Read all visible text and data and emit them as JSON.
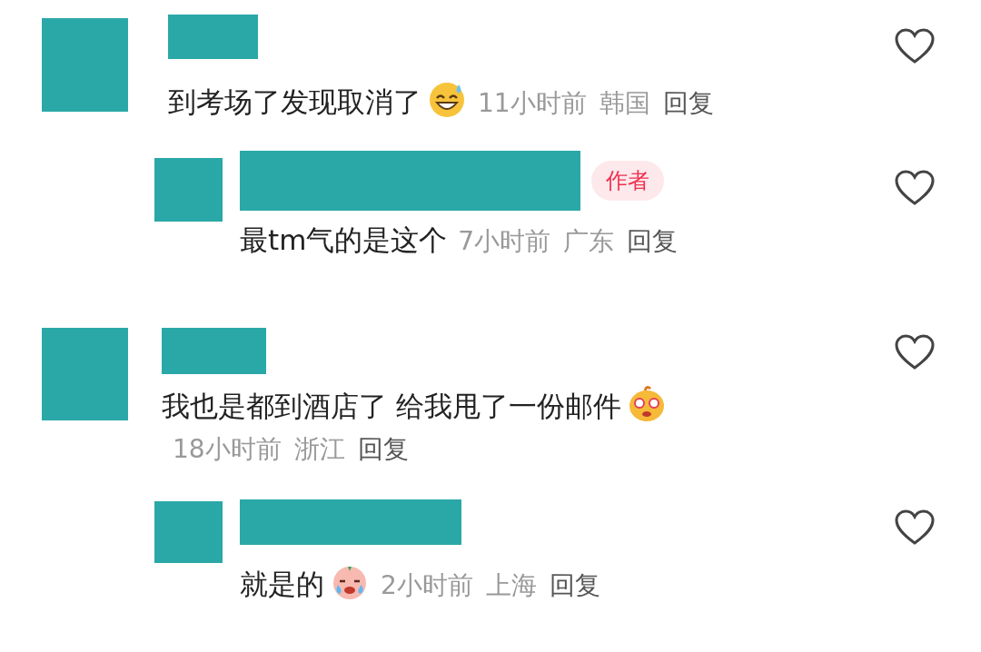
{
  "comments": [
    {
      "text": "到考场了发现取消了",
      "emoji": {
        "kind": "sweat"
      },
      "time": "11小时前",
      "location": "韩国",
      "reply_label": "回复",
      "liked": false,
      "replies": [
        {
          "text": "最tm气的是这个",
          "badge": "作者",
          "time": "7小时前",
          "location": "广东",
          "reply_label": "回复",
          "liked": false
        }
      ]
    },
    {
      "text": "我也是都到酒店了 给我甩了一份邮件",
      "emoji": {
        "kind": "dizzy"
      },
      "time": "18小时前",
      "location": "浙江",
      "reply_label": "回复",
      "liked": false,
      "replies": [
        {
          "text": "就是的",
          "emoji": {
            "kind": "cry"
          },
          "time": "2小时前",
          "location": "上海",
          "reply_label": "回复",
          "liked": false
        }
      ]
    }
  ]
}
